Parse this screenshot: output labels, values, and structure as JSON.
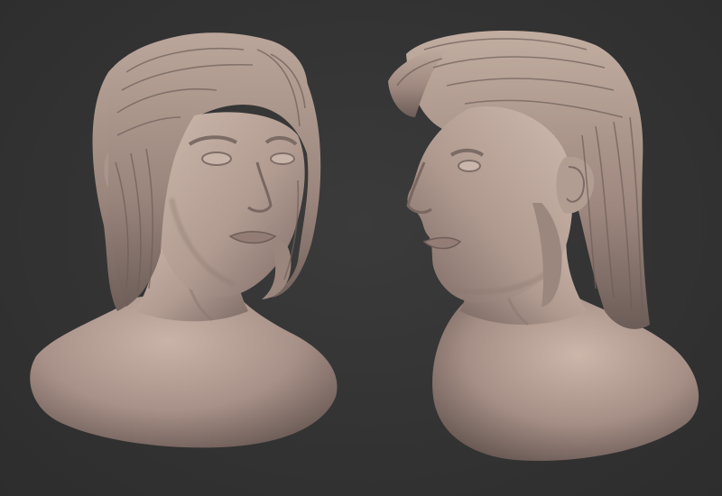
{
  "scene": {
    "subject": "sculpted-bust-pair",
    "views": [
      {
        "id": "bust-front-three-quarter",
        "facing": "front-right"
      },
      {
        "id": "bust-profile-left",
        "facing": "left"
      }
    ],
    "colors": {
      "background": "#353535",
      "clay_light": "#c8b2a6",
      "clay_mid": "#a8928a",
      "clay_dark": "#6f5f5a",
      "hair_shadow": "#4f4440"
    }
  }
}
